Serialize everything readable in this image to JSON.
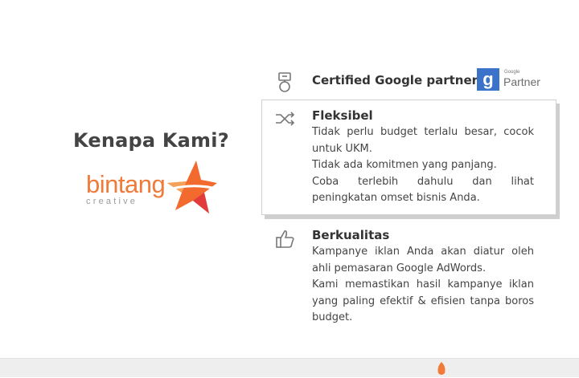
{
  "section": {
    "heading": "Kenapa Kami?"
  },
  "brand": {
    "logo_word": "bintang",
    "logo_sub": "creative",
    "logo_color": "#f07a3a",
    "star_colors": [
      "#f26a2e",
      "#e23b3b",
      "#f7a05a"
    ]
  },
  "features": [
    {
      "icon": "badge-icon",
      "title": "Certified Google partner.",
      "lines": []
    },
    {
      "icon": "shuffle-icon",
      "title": "Fleksibel",
      "lines": [
        "Tidak perlu budget terlalu besar, cocok untuk UKM.",
        "Tidak ada komitmen yang panjang.",
        "Coba terlebih dahulu dan lihat peningkatan omset bisnis Anda."
      ]
    },
    {
      "icon": "thumbs-up-icon",
      "title": "Berkualitas",
      "lines": [
        "Kampanye iklan Anda akan diatur oleh ahli pemasaran Google AdWords.",
        "Kami memastikan hasil kampanye iklan yang paling efektif & efisien tanpa boros budget."
      ]
    }
  ],
  "partner_badge": {
    "g": "g",
    "small": "Google",
    "big": "Partner",
    "color": "#3a73c9"
  }
}
